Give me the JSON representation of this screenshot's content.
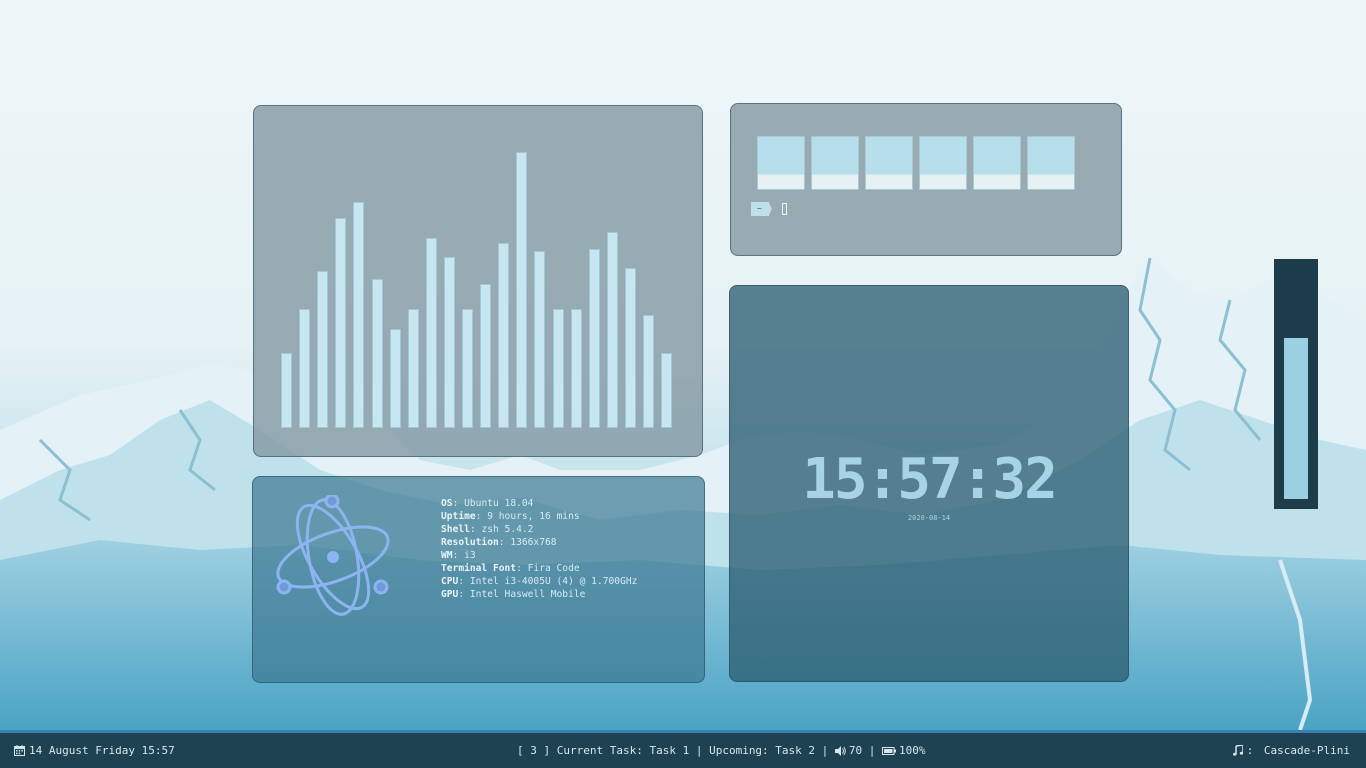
{
  "sysinfo": [
    {
      "key": "OS",
      "value": "Ubuntu 18.04"
    },
    {
      "key": "Uptime",
      "value": "9 hours, 16 mins"
    },
    {
      "key": "Shell",
      "value": "zsh 5.4.2"
    },
    {
      "key": "Resolution",
      "value": "1366x768"
    },
    {
      "key": "WM",
      "value": "i3"
    },
    {
      "key": "Terminal Font",
      "value": "Fira Code"
    },
    {
      "key": "CPU",
      "value": "Intel i3-4005U (4) @ 1.700GHz"
    },
    {
      "key": "GPU",
      "value": "Intel Haswell Mobile"
    }
  ],
  "clock": {
    "time": "15:57:32",
    "date": "2020-08-14"
  },
  "terminal": {
    "prompt": "~",
    "workspace_count": 6
  },
  "visualizer": {
    "levels": [
      0.27,
      0.43,
      0.57,
      0.76,
      0.82,
      0.54,
      0.36,
      0.43,
      0.69,
      0.62,
      0.43,
      0.52,
      0.67,
      1.0,
      0.64,
      0.43,
      0.43,
      0.65,
      0.71,
      0.58,
      0.41,
      0.27
    ]
  },
  "volume_meter": {
    "level": 0.7
  },
  "taskbar": {
    "date": "14 August Friday 15:57",
    "workspace": "[ 3 ]",
    "current_task": "Current Task: Task 1",
    "sep1": " | ",
    "upcoming_task": "Upcoming: Task 2",
    "sep2": " | ",
    "volume": "70",
    "sep3": " | ",
    "battery": "100%",
    "music_sep": ": ",
    "music": "Cascade-Plini"
  },
  "colors": {
    "accent": "#3c7fb5",
    "bar": "#c8e6f0",
    "clock": "#a6d4e6"
  }
}
